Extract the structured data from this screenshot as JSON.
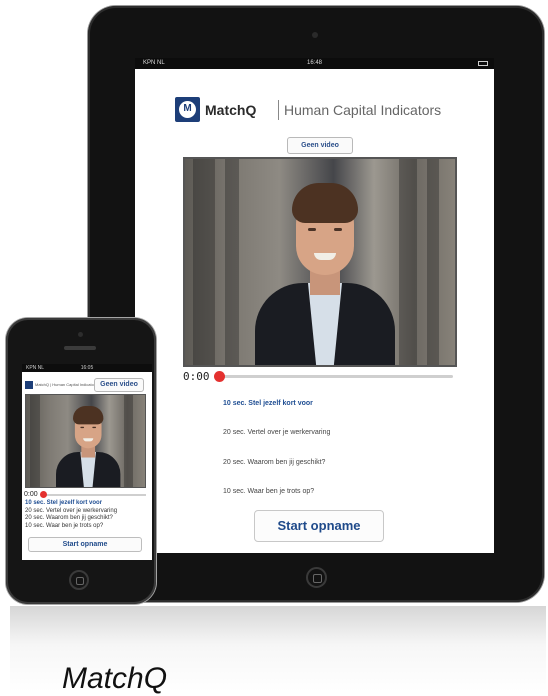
{
  "ipad": {
    "status": {
      "carrier": "KPN NL",
      "time": "16:48"
    },
    "brand": {
      "name": "MatchQ",
      "tagline": "Human Capital Indicators",
      "logo_letter": "M"
    },
    "video_button": "Geen video",
    "player": {
      "timecode": "0:00",
      "progress": 0
    },
    "questions": [
      {
        "text": "10 sec. Stel jezelf kort voor",
        "active": true
      },
      {
        "text": "20 sec. Vertel over je werkervaring",
        "active": false
      },
      {
        "text": "20 sec. Waarom ben jij geschikt?",
        "active": false
      },
      {
        "text": "10 sec. Waar ben je trots op?",
        "active": false
      }
    ],
    "start_button": "Start opname"
  },
  "iphone": {
    "status": {
      "carrier": "KPN NL",
      "time": "16:05"
    },
    "brand_line": "MatchQ | Human Capital Indicators",
    "video_button": "Geen video",
    "player": {
      "timecode": "0:00",
      "progress": 0
    },
    "questions": [
      {
        "text": "10 sec. Stel jezelf kort voor",
        "active": true
      },
      {
        "text": "20 sec. Vertel over je werkervaring",
        "active": false
      },
      {
        "text": "20 sec. Waarom ben jij geschikt?",
        "active": false
      },
      {
        "text": "10 sec. Waar ben je trots op?",
        "active": false
      }
    ],
    "start_button": "Start opname"
  },
  "caption": "MatchQ",
  "colors": {
    "brand_blue": "#1d3e78",
    "accent_red": "#e4312f",
    "link_blue": "#1e4d92"
  }
}
